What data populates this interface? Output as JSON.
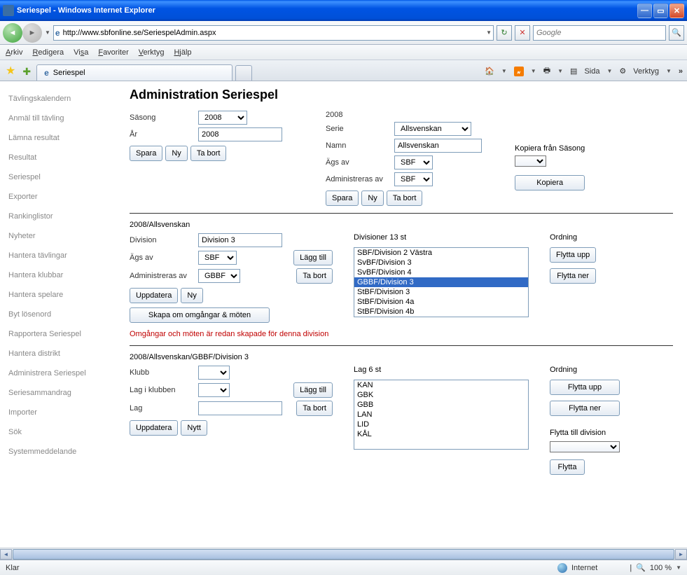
{
  "window": {
    "title": "Seriespel - Windows Internet Explorer"
  },
  "address": {
    "url": "http://www.sbfonline.se/SeriespelAdmin.aspx"
  },
  "search": {
    "placeholder": "Google"
  },
  "menubar": {
    "arkiv": "Arkiv",
    "redigera": "Redigera",
    "visa": "Visa",
    "favoriter": "Favoriter",
    "verktyg": "Verktyg",
    "hjalp": "Hjälp"
  },
  "tab": {
    "title": "Seriespel"
  },
  "toolbar": {
    "sida": "Sida",
    "verktyg": "Verktyg"
  },
  "sidebar": {
    "items": [
      "Tävlingskalendern",
      "Anmäl till tävling",
      "Lämna resultat",
      "Resultat",
      "Seriespel",
      "Exporter",
      "Rankinglistor",
      "Nyheter",
      "Hantera tävlingar",
      "Hantera klubbar",
      "Hantera spelare",
      "Byt lösenord",
      "Rapportera Seriespel",
      "Hantera distrikt",
      "Administrera Seriespel",
      "Seriesammandrag",
      "Importer",
      "Sök",
      "Systemmeddelande"
    ]
  },
  "page": {
    "title": "Administration Seriespel",
    "sasong_label": "Säsong",
    "sasong_value": "2008",
    "ar_label": "År",
    "ar_value": "2008",
    "spara": "Spara",
    "ny": "Ny",
    "tabort": "Ta bort",
    "year_display": "2008",
    "serie_label": "Serie",
    "serie_value": "Allsvenskan",
    "namn_label": "Namn",
    "namn_value": "Allsvenskan",
    "ags_label": "Ägs av",
    "ags_value": "SBF",
    "admin_label": "Administreras av",
    "admin_value": "SBF",
    "kopiera_label": "Kopiera från Säsong",
    "kopiera_btn": "Kopiera",
    "breadcrumb1": "2008/Allsvenskan",
    "division_label": "Division",
    "division_value": "Division 3",
    "div_ags_value": "SBF",
    "div_admin_value": "GBBF",
    "lagg_till": "Lägg till",
    "uppdatera": "Uppdatera",
    "skapa_om": "Skapa om omgångar & möten",
    "redmsg": "Omgångar och möten är redan skapade för denna division",
    "divisioner_label": "Divisioner 13 st",
    "divisioner": [
      "SBF/Division 2 Västra",
      "SvBF/Division 3",
      "SvBF/Division 4",
      "GBBF/Division 3",
      "StBF/Division 3",
      "StBF/Division 4a",
      "StBF/Division 4b"
    ],
    "div_selected_index": 3,
    "ordning_label": "Ordning",
    "flytta_upp": "Flytta upp",
    "flytta_ner": "Flytta ner",
    "breadcrumb2": "2008/Allsvenskan/GBBF/Division 3",
    "klubb_label": "Klubb",
    "lag_klubb_label": "Lag i klubben",
    "lag_label": "Lag",
    "nytt": "Nytt",
    "lag_header": "Lag 6 st",
    "lag_list": [
      "KAN",
      "GBK",
      "GBB",
      "LAN",
      "LID",
      "KÅL"
    ],
    "flytta_div_label": "Flytta till division",
    "flytta_btn": "Flytta"
  },
  "status": {
    "klar": "Klar",
    "zone": "Internet",
    "zoom": "100 %"
  }
}
